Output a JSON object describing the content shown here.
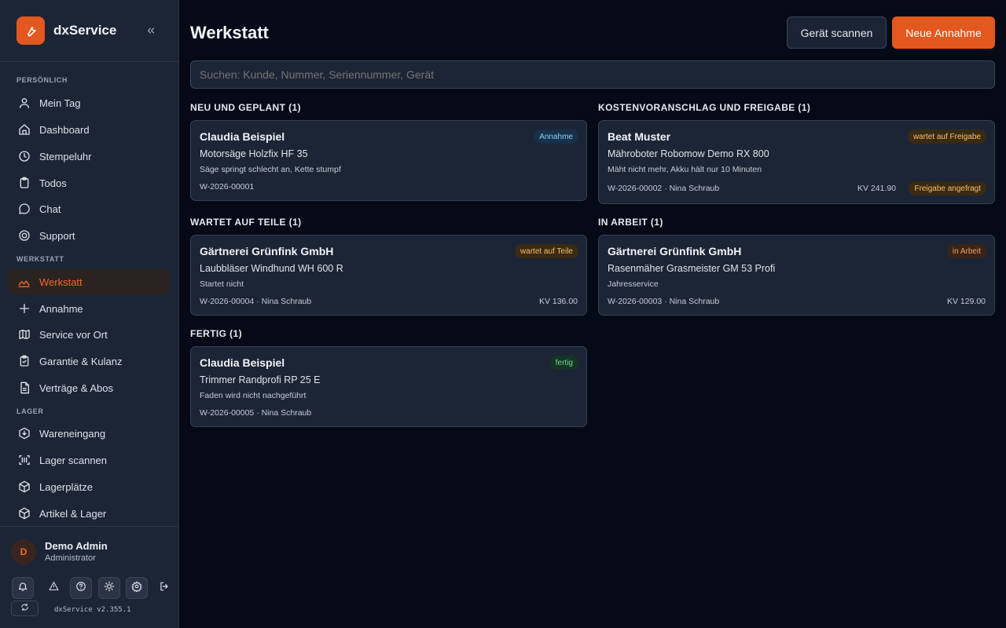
{
  "app": {
    "name": "dxService",
    "accent": "#e2581e"
  },
  "sidebar": {
    "sections": [
      {
        "label": "PERSÖNLICH"
      },
      {
        "label": "WERKSTATT"
      },
      {
        "label": "LAGER"
      }
    ],
    "items": [
      {
        "label": "Mein Tag",
        "icon": "user-icon"
      },
      {
        "label": "Dashboard",
        "icon": "home-icon"
      },
      {
        "label": "Stempeluhr",
        "icon": "clock-icon"
      },
      {
        "label": "Todos",
        "icon": "clipboard-icon"
      },
      {
        "label": "Chat",
        "icon": "chat-icon"
      },
      {
        "label": "Support",
        "icon": "lifebuoy-icon"
      },
      {
        "label": "Werkstatt",
        "icon": "wrench-icon",
        "active": true
      },
      {
        "label": "Annahme",
        "icon": "plus-icon"
      },
      {
        "label": "Service vor Ort",
        "icon": "map-icon"
      },
      {
        "label": "Garantie & Kulanz",
        "icon": "clipboard-check-icon"
      },
      {
        "label": "Verträge & Abos",
        "icon": "file-icon"
      },
      {
        "label": "Wareneingang",
        "icon": "download-icon"
      },
      {
        "label": "Lager scannen",
        "icon": "barcode-icon"
      },
      {
        "label": "Lagerplätze",
        "icon": "box-icon"
      },
      {
        "label": "Artikel & Lager",
        "icon": "package-icon"
      }
    ],
    "user": {
      "initial": "D",
      "name": "Demo Admin",
      "role": "Administrator"
    },
    "version": "dxService v2.355.1"
  },
  "main": {
    "title": "Werkstatt",
    "scan_label": "Gerät scannen",
    "new_label": "Neue Annahme",
    "search_placeholder": "Suchen: Kunde, Nummer, Seriennummer, Gerät",
    "columns": [
      {
        "title": "NEU UND GEPLANT (1)"
      },
      {
        "title": "KOSTENVORANSCHLAG UND FREIGABE (1)"
      },
      {
        "title": "WARTET AUF TEILE (1)"
      },
      {
        "title": "IN ARBEIT (1)"
      },
      {
        "title": "FERTIG (1)"
      }
    ],
    "cards": [
      {
        "customer": "Claudia Beispiel",
        "device": "Motorsäge Holzfix HF 35",
        "issue": "Säge springt schlecht an, Kette stumpf",
        "meta": "W-2026-00001",
        "status": "Annahme"
      },
      {
        "customer": "Beat Muster",
        "device": "Mähroboter Robomow Demo RX 800",
        "issue": "Mäht nicht mehr, Akku hält nur 10 Minuten",
        "meta": "W-2026-00002 · Nina Schraub",
        "status": "wartet auf Freigabe",
        "kv": "KV 241.90",
        "extra": "Freigabe angefragt"
      },
      {
        "customer": "Gärtnerei Grünfink GmbH",
        "device": "Laubbläser Windhund WH 600 R",
        "issue": "Startet nicht",
        "meta": "W-2026-00004 · Nina Schraub",
        "status": "wartet auf Teile",
        "kv": "KV 136.00"
      },
      {
        "customer": "Gärtnerei Grünfink GmbH",
        "device": "Rasenmäher Grasmeister GM 53 Profi",
        "issue": "Jahresservice",
        "meta": "W-2026-00003 · Nina Schraub",
        "status": "in Arbeit",
        "kv": "KV 129.00"
      },
      {
        "customer": "Claudia Beispiel",
        "device": "Trimmer Randprofi RP 25 E",
        "issue": "Faden wird nicht nachgeführt",
        "meta": "W-2026-00005 · Nina Schraub",
        "status": "fertig"
      }
    ]
  }
}
